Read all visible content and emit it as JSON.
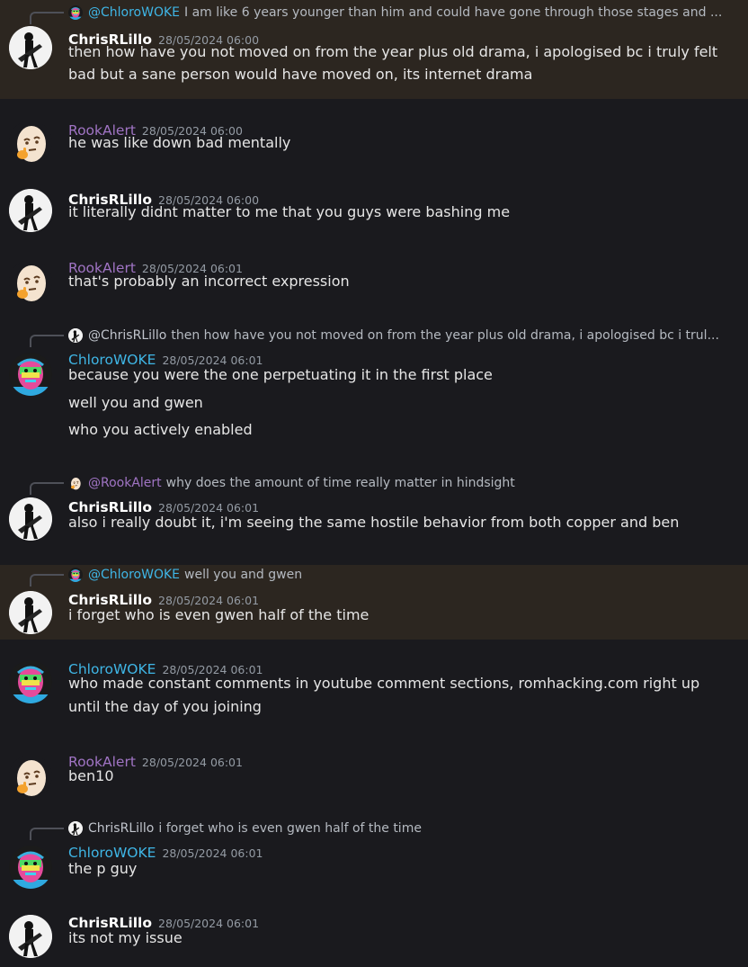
{
  "messages": [
    {
      "author": "ChrisRLillo",
      "timestamp": "28/05/2024 06:00",
      "reply": {
        "author": "@ChloroWOKE",
        "text": "I am like 6 years younger than him and could have gone through those stages and ..."
      },
      "lines": [
        "then how have you not moved on from the year plus old drama, i apologised bc i truly felt",
        "bad but a sane person would have moved on, its internet drama"
      ]
    },
    {
      "author": "RookAlert",
      "timestamp": "28/05/2024 06:00",
      "lines": [
        "he was like down bad mentally"
      ]
    },
    {
      "author": "ChrisRLillo",
      "timestamp": "28/05/2024 06:00",
      "lines": [
        "it literally didnt matter to me that you guys were bashing me"
      ]
    },
    {
      "author": "RookAlert",
      "timestamp": "28/05/2024 06:01",
      "lines": [
        "that's probably an incorrect expression"
      ]
    },
    {
      "author": "ChloroWOKE",
      "timestamp": "28/05/2024 06:01",
      "reply": {
        "author": "@ChrisRLillo",
        "text": "then how have you not moved on from the year plus old drama, i apologised bc i trul..."
      },
      "lines": [
        "because you were the one perpetuating it in the first place",
        "well you and gwen",
        "who you actively enabled"
      ]
    },
    {
      "author": "ChrisRLillo",
      "timestamp": "28/05/2024 06:01",
      "reply": {
        "author": "@RookAlert",
        "text": "why does the amount of time really matter in hindsight"
      },
      "lines": [
        "also i really doubt it, i'm seeing the same hostile behavior from both copper and ben"
      ]
    },
    {
      "author": "ChrisRLillo",
      "timestamp": "28/05/2024 06:01",
      "reply": {
        "author": "@ChloroWOKE",
        "text": "well you and gwen"
      },
      "lines": [
        "i forget who is even gwen half of the time"
      ]
    },
    {
      "author": "ChloroWOKE",
      "timestamp": "28/05/2024 06:01",
      "lines": [
        "who made constant comments in youtube comment sections, romhacking.com right up",
        "until the day of you joining"
      ]
    },
    {
      "author": "RookAlert",
      "timestamp": "28/05/2024 06:01",
      "lines": [
        "ben10"
      ]
    },
    {
      "author": "ChloroWOKE",
      "timestamp": "28/05/2024 06:01",
      "reply": {
        "author": "ChrisRLillo",
        "text": "i forget who is even gwen half of the time"
      },
      "lines": [
        "the p guy"
      ]
    },
    {
      "author": "ChrisRLillo",
      "timestamp": "28/05/2024 06:01",
      "lines": [
        "its not my issue"
      ]
    }
  ],
  "colors": {
    "background": "#1a1a1e",
    "mention_highlight": "#2c2620",
    "ChrisRLillo": "#ffffff",
    "RookAlert": "#a074c4",
    "ChloroWOKE": "#3fb6e6"
  },
  "avatars": {
    "ChrisRLillo": "guitarist-avatar-icon",
    "RookAlert": "thinking-egg-avatar-icon",
    "ChloroWOKE": "colorful-face-avatar-icon"
  }
}
